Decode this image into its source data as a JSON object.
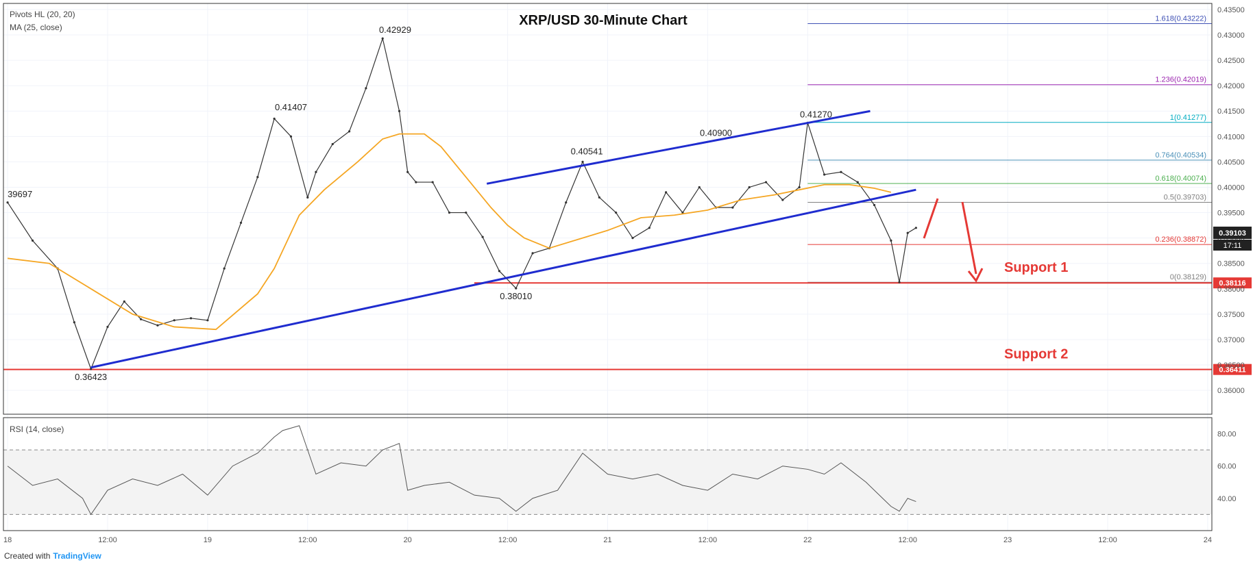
{
  "chart_data": {
    "type": "line",
    "title": "XRP/USD 30-Minute Chart",
    "indicators": {
      "pivots": "Pivots HL (20, 20)",
      "ma": "MA (25, close)",
      "rsi": "RSI (14, close)"
    },
    "y_ticks": [
      "0.43500",
      "0.43000",
      "0.42500",
      "0.42000",
      "0.41500",
      "0.41000",
      "0.40500",
      "0.40000",
      "0.39500",
      "0.39000",
      "0.38500",
      "0.38000",
      "0.37500",
      "0.37000",
      "0.36500",
      "0.36000"
    ],
    "y_tick_values": [
      0.435,
      0.43,
      0.425,
      0.42,
      0.415,
      0.41,
      0.405,
      0.4,
      0.395,
      0.39,
      0.385,
      0.38,
      0.375,
      0.37,
      0.365,
      0.36
    ],
    "ylim": [
      0.3553,
      0.4362
    ],
    "x_ticks": [
      "18",
      "12:00",
      "19",
      "12:00",
      "20",
      "12:00",
      "21",
      "12:00",
      "22",
      "12:00",
      "23",
      "12:00",
      "24"
    ],
    "x_tick_values": [
      0,
      24,
      48,
      72,
      96,
      120,
      144,
      168,
      192,
      216,
      240,
      264,
      288
    ],
    "xlim": [
      -1,
      289
    ],
    "series": [
      {
        "name": "",
        "x": [
          0,
          6,
          12,
          16,
          20,
          24,
          28,
          32,
          36,
          40,
          44,
          48,
          52,
          56,
          60,
          64,
          68,
          72,
          74,
          78,
          82,
          86,
          90,
          94,
          96,
          98,
          102,
          106,
          110,
          114,
          118,
          122,
          126,
          130,
          134,
          138,
          142,
          146,
          150,
          154,
          158,
          162,
          166,
          170,
          174,
          178,
          182,
          186,
          190,
          192,
          196,
          200,
          204,
          208,
          212,
          214,
          216,
          218
        ],
        "y": [
          0.397,
          0.3895,
          0.384,
          0.3734,
          0.3642,
          0.3725,
          0.3775,
          0.374,
          0.3728,
          0.3738,
          0.3742,
          0.3738,
          0.384,
          0.393,
          0.402,
          0.4135,
          0.41,
          0.398,
          0.403,
          0.4085,
          0.411,
          0.4195,
          0.4293,
          0.415,
          0.403,
          0.401,
          0.401,
          0.395,
          0.395,
          0.3902,
          0.3835,
          0.3801,
          0.387,
          0.388,
          0.397,
          0.405,
          0.398,
          0.395,
          0.39,
          0.392,
          0.399,
          0.395,
          0.4,
          0.396,
          0.396,
          0.4,
          0.401,
          0.3975,
          0.4,
          0.4127,
          0.4025,
          0.403,
          0.401,
          0.3965,
          0.3895,
          0.3813,
          0.391,
          0.392
        ]
      }
    ],
    "ma_series": {
      "name": "MA (25, close)",
      "x": [
        0,
        10,
        20,
        30,
        40,
        50,
        60,
        64,
        70,
        76,
        84,
        90,
        94,
        100,
        104,
        110,
        116,
        120,
        124,
        130,
        138,
        144,
        152,
        160,
        168,
        176,
        184,
        190,
        196,
        202,
        208,
        212
      ],
      "y": [
        0.386,
        0.385,
        0.38,
        0.375,
        0.3725,
        0.372,
        0.379,
        0.384,
        0.3945,
        0.3995,
        0.405,
        0.4095,
        0.4105,
        0.4105,
        0.408,
        0.402,
        0.396,
        0.3925,
        0.39,
        0.388,
        0.39,
        0.3915,
        0.394,
        0.3945,
        0.3955,
        0.3975,
        0.3985,
        0.3995,
        0.4005,
        0.4005,
        0.3998,
        0.399
      ]
    },
    "pivot_labels": [
      {
        "x": 0,
        "y": 0.39697,
        "text": "39697"
      },
      {
        "x": 20,
        "y": 0.36423,
        "text": "0.36423"
      },
      {
        "x": 68,
        "y": 0.41407,
        "text": "0.41407"
      },
      {
        "x": 93,
        "y": 0.42929,
        "text": "0.42929"
      },
      {
        "x": 122,
        "y": 0.3801,
        "text": "0.38010"
      },
      {
        "x": 139,
        "y": 0.40541,
        "text": "0.40541"
      },
      {
        "x": 170,
        "y": 0.409,
        "text": "0.40900"
      },
      {
        "x": 194,
        "y": 0.4127,
        "text": "0.41270"
      }
    ],
    "fib_levels": [
      {
        "label": "1.618(0.43222)",
        "value": 0.43222,
        "color": "#3f51b5"
      },
      {
        "label": "1.236(0.42019)",
        "value": 0.42019,
        "color": "#9c27b0"
      },
      {
        "label": "1(0.41277)",
        "value": 0.41277,
        "color": "#00acc1"
      },
      {
        "label": "0.764(0.40534)",
        "value": 0.40534,
        "color": "#4a90b8"
      },
      {
        "label": "0.618(0.40074)",
        "value": 0.40074,
        "color": "#4caf50"
      },
      {
        "label": "0.5(0.39703)",
        "value": 0.39703,
        "color": "#808080"
      },
      {
        "label": "0.236(0.38872)",
        "value": 0.38872,
        "color": "#e53935"
      },
      {
        "label": "0(0.38129)",
        "value": 0.38129,
        "color": "#808080"
      }
    ],
    "support_lines": [
      {
        "label": "Support 1",
        "value": 0.38116,
        "price_tag": "0.38116"
      },
      {
        "label": "Support 2",
        "value": 0.36411,
        "price_tag": "0.36411"
      }
    ],
    "trend_lines": [
      {
        "x1": 20,
        "y1": 0.3645,
        "x2": 218,
        "y2": 0.3995
      },
      {
        "x1": 115,
        "y1": 0.4007,
        "x2": 207,
        "y2": 0.415
      }
    ],
    "current_price": {
      "value": 0.39103,
      "label": "0.39103",
      "countdown": "17:11"
    },
    "rsi": {
      "ylim": [
        20,
        90
      ],
      "y_ticks": [
        "80.00",
        "60.00",
        "40.00"
      ],
      "y_tick_values": [
        80,
        60,
        40
      ],
      "bands": [
        70,
        30
      ],
      "x": [
        0,
        6,
        12,
        18,
        20,
        24,
        30,
        36,
        42,
        48,
        54,
        60,
        64,
        66,
        70,
        72,
        74,
        80,
        86,
        90,
        94,
        96,
        100,
        106,
        112,
        118,
        122,
        126,
        132,
        138,
        144,
        150,
        156,
        162,
        168,
        174,
        180,
        186,
        192,
        196,
        200,
        206,
        210,
        212,
        214,
        216,
        218
      ],
      "y": [
        60,
        48,
        52,
        40,
        30,
        45,
        52,
        48,
        55,
        42,
        60,
        68,
        78,
        82,
        85,
        70,
        55,
        62,
        60,
        70,
        74,
        45,
        48,
        50,
        42,
        40,
        32,
        40,
        45,
        68,
        55,
        52,
        55,
        48,
        45,
        55,
        52,
        60,
        58,
        55,
        62,
        50,
        40,
        35,
        32,
        40,
        38
      ]
    }
  },
  "footer": {
    "created_with": "Created with",
    "brand": "TradingView"
  }
}
